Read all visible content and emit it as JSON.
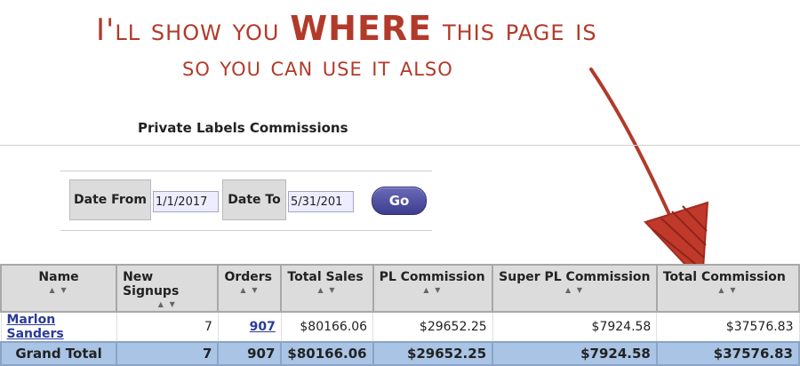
{
  "annotation": {
    "line1_pre": "I'll show you ",
    "line1_emph": "WHERE",
    "line1_post": " this page is",
    "line2": "so you can use it also",
    "color": "#b23a2a"
  },
  "page": {
    "title": "Private Labels Commissions"
  },
  "filter": {
    "date_from_label": "Date From",
    "date_from_value": "1/1/2017",
    "date_to_label": "Date To",
    "date_to_value": "5/31/201",
    "go_label": "Go"
  },
  "table": {
    "columns": [
      "Name",
      "New Signups",
      "Orders",
      "Total Sales",
      "PL Commission",
      "Super PL Commission",
      "Total Commission"
    ],
    "sort_glyph": "▲ ▼",
    "rows": [
      {
        "name": "Marlon Sanders",
        "new_signups": "7",
        "orders": "907",
        "total_sales": "$80166.06",
        "pl_commission": "$29652.25",
        "super_pl_commission": "$7924.58",
        "total_commission": "$37576.83"
      }
    ],
    "grand_total": {
      "name": "Grand Total",
      "new_signups": "7",
      "orders": "907",
      "total_sales": "$80166.06",
      "pl_commission": "$29652.25",
      "super_pl_commission": "$7924.58",
      "total_commission": "$37576.83"
    }
  }
}
